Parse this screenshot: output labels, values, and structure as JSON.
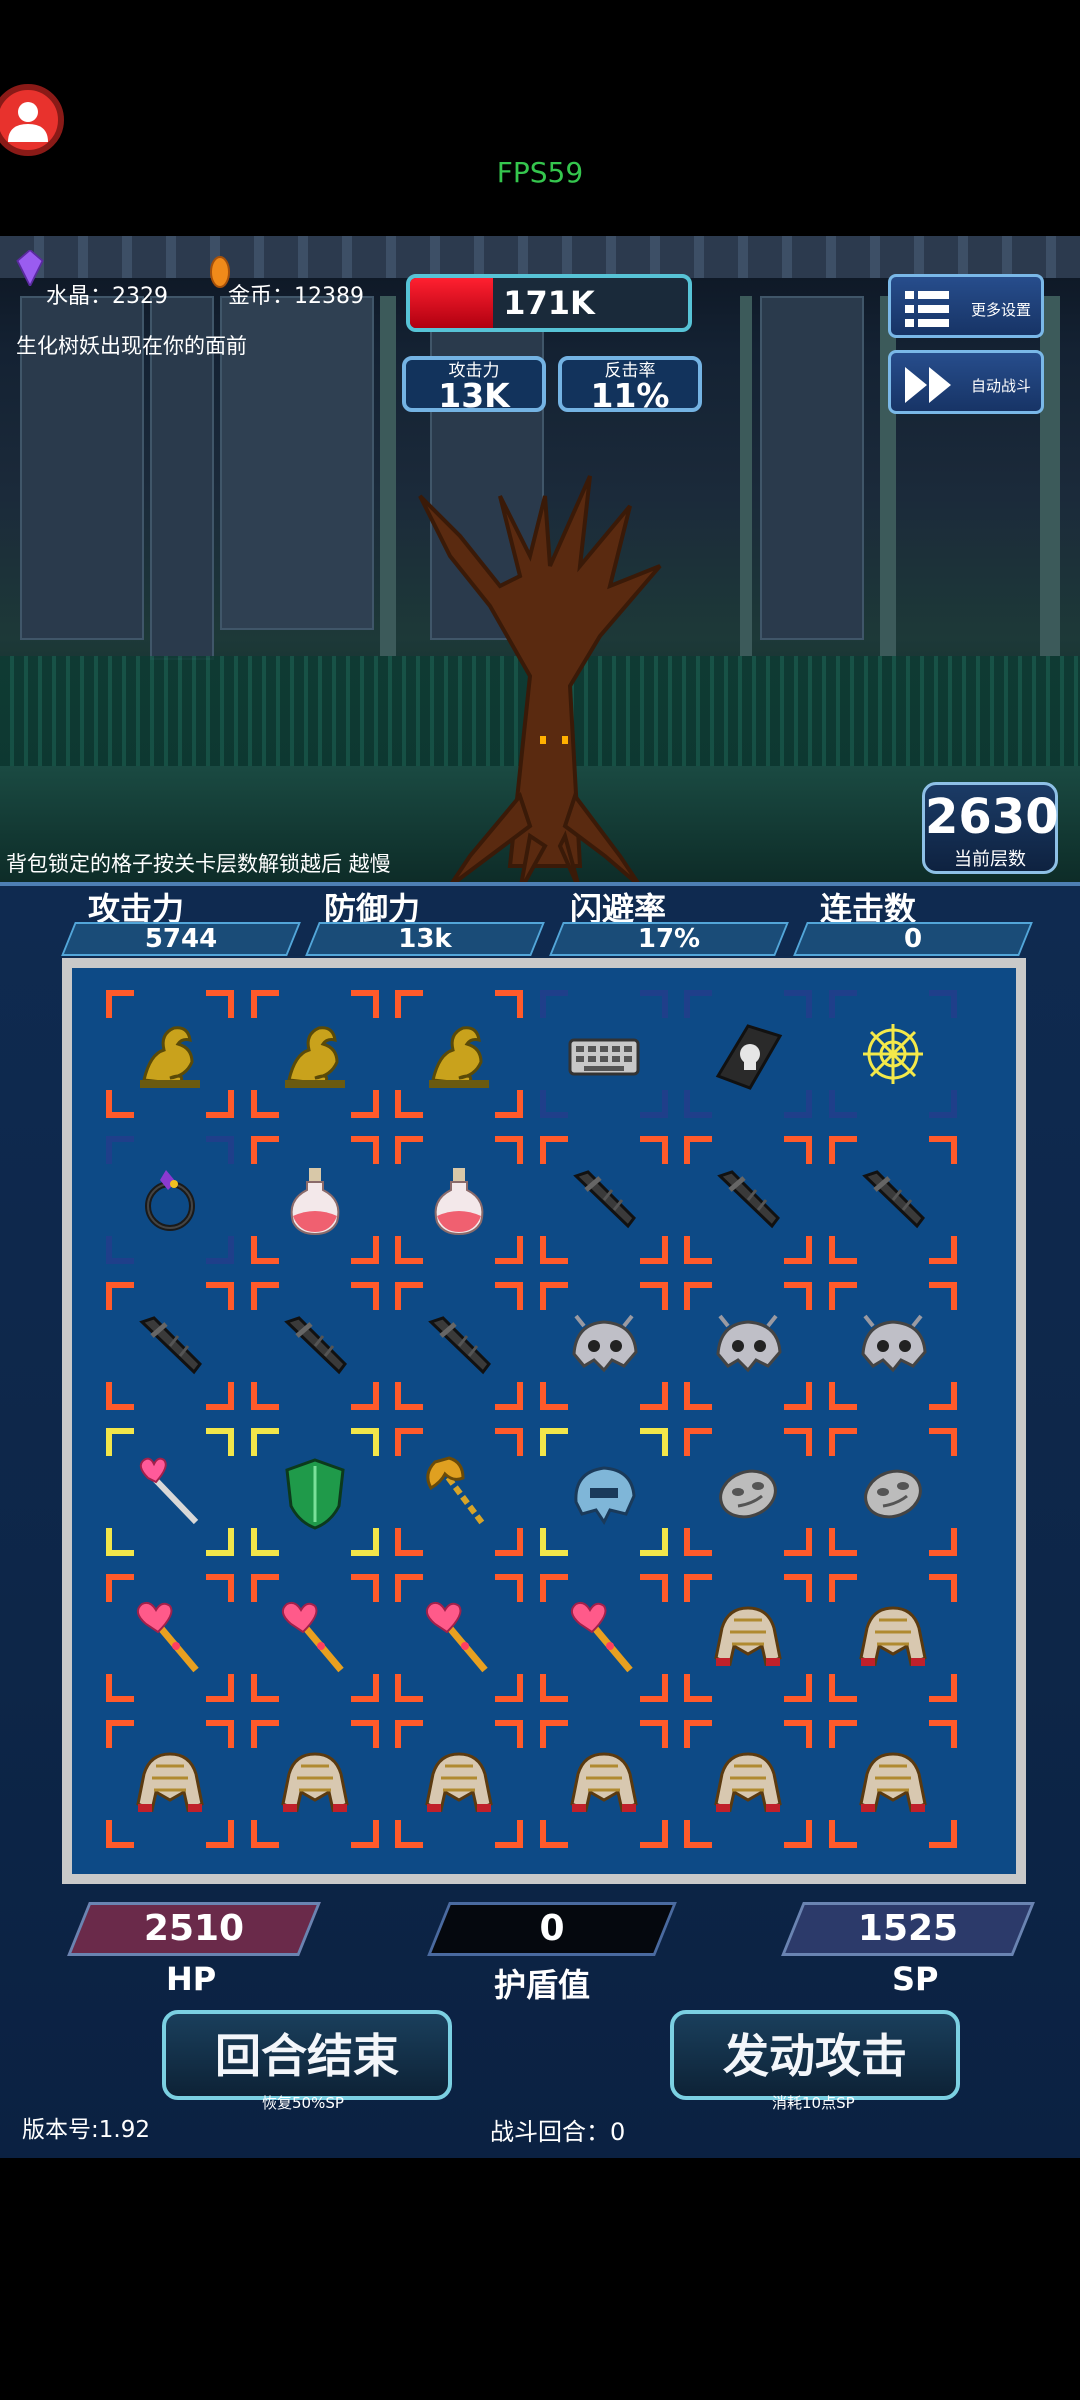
{
  "fps": "FPS59",
  "resources": {
    "crystal_label": "水晶：",
    "crystal_value": "2329",
    "gold_label": "金币：",
    "gold_value": "12389"
  },
  "event_message": "生化树妖出现在你的面前",
  "boss": {
    "hp_text": "171K",
    "hp_fraction": 0.3
  },
  "enemy_stats": {
    "attack_label": "攻击力",
    "attack_value": "13K",
    "counter_label": "反击率",
    "counter_value": "11%"
  },
  "buttons": {
    "more_settings": "更多设置",
    "auto_battle": "自动战斗",
    "end_turn": "回合结束",
    "attack": "发动攻击"
  },
  "floor": {
    "value": "2630",
    "label": "当前层数"
  },
  "lock_note": "背包锁定的格子按关卡层数解锁越后  越慢",
  "player_stats": [
    {
      "label": "攻击力",
      "value": "5744"
    },
    {
      "label": "防御力",
      "value": "13k"
    },
    {
      "label": "闪避率",
      "value": "17%"
    },
    {
      "label": "连击数",
      "value": "0"
    }
  ],
  "inventory": [
    [
      "dragon",
      "dragon",
      "dragon",
      "keyboard",
      "skull-book",
      "spark-web"
    ],
    [
      "dark-ring",
      "potion",
      "potion",
      "dark-blade",
      "dark-blade",
      "dark-blade"
    ],
    [
      "dark-blade",
      "dark-blade",
      "dark-blade",
      "bone-helmet",
      "bone-helmet",
      "bone-helmet"
    ],
    [
      "heart-wand",
      "green-shield",
      "double-axe",
      "steel-helmet",
      "stone-mask",
      "stone-mask"
    ],
    [
      "heart-staff",
      "heart-staff",
      "heart-staff",
      "heart-staff",
      "gold-armor",
      "gold-armor"
    ],
    [
      "gold-armor",
      "gold-armor",
      "gold-armor",
      "gold-armor",
      "gold-armor",
      "gold-armor"
    ]
  ],
  "cell_frames": [
    [
      "red",
      "red",
      "red",
      "blue",
      "blue",
      "blue"
    ],
    [
      "blue",
      "red",
      "red",
      "red",
      "red",
      "red"
    ],
    [
      "red",
      "red",
      "red",
      "red",
      "red",
      "red"
    ],
    [
      "yellow",
      "yellow",
      "red",
      "yellow",
      "red",
      "red"
    ],
    [
      "red",
      "red",
      "red",
      "red",
      "red",
      "red"
    ],
    [
      "red",
      "red",
      "red",
      "red",
      "red",
      "red"
    ]
  ],
  "vitals": {
    "hp_value": "2510",
    "hp_label": "HP",
    "shield_value": "0",
    "shield_label": "护盾值",
    "sp_value": "1525",
    "sp_label": "SP"
  },
  "button_subtexts": {
    "end_turn": "恢复50%SP",
    "attack": "消耗10点SP"
  },
  "footer": {
    "version": "版本号:1.92",
    "round_label": "战斗回合：",
    "round_value": "0"
  },
  "colors": {
    "frame_red": "#ff5a2a",
    "frame_blue": "#1f3f8a",
    "frame_yellow": "#f2e64a"
  }
}
